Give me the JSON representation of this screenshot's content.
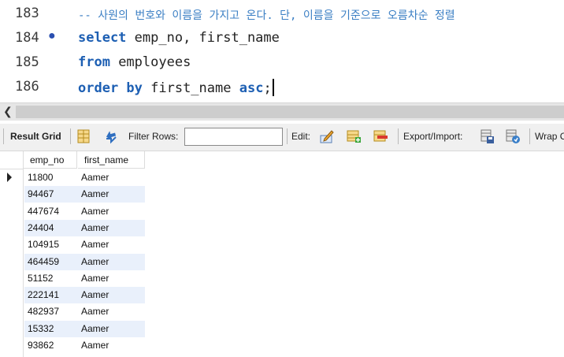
{
  "editor": {
    "lines": [
      {
        "num": "183",
        "comment": "-- 사원의 번호와 이름을 가지고 온다. 단, 이름을 기준으로 오름차순 정렬"
      },
      {
        "num": "184",
        "kw1": "select",
        "text1": " emp_no, first_name"
      },
      {
        "num": "185",
        "kw1": "from",
        "text1": " employees"
      },
      {
        "num": "186",
        "kw1": "order by",
        "text1": " first_name ",
        "kw2": "asc",
        "text2": ";"
      }
    ]
  },
  "toolbar": {
    "result_grid": "Result Grid",
    "filter_rows": "Filter Rows:",
    "filter_value": "",
    "edit": "Edit:",
    "export_import": "Export/Import:",
    "wrap": "Wrap C"
  },
  "grid": {
    "columns": [
      "emp_no",
      "first_name"
    ],
    "rows": [
      [
        "11800",
        "Aamer"
      ],
      [
        "94467",
        "Aamer"
      ],
      [
        "447674",
        "Aamer"
      ],
      [
        "24404",
        "Aamer"
      ],
      [
        "104915",
        "Aamer"
      ],
      [
        "464459",
        "Aamer"
      ],
      [
        "51152",
        "Aamer"
      ],
      [
        "222141",
        "Aamer"
      ],
      [
        "482937",
        "Aamer"
      ],
      [
        "15332",
        "Aamer"
      ],
      [
        "93862",
        "Aamer"
      ]
    ]
  }
}
